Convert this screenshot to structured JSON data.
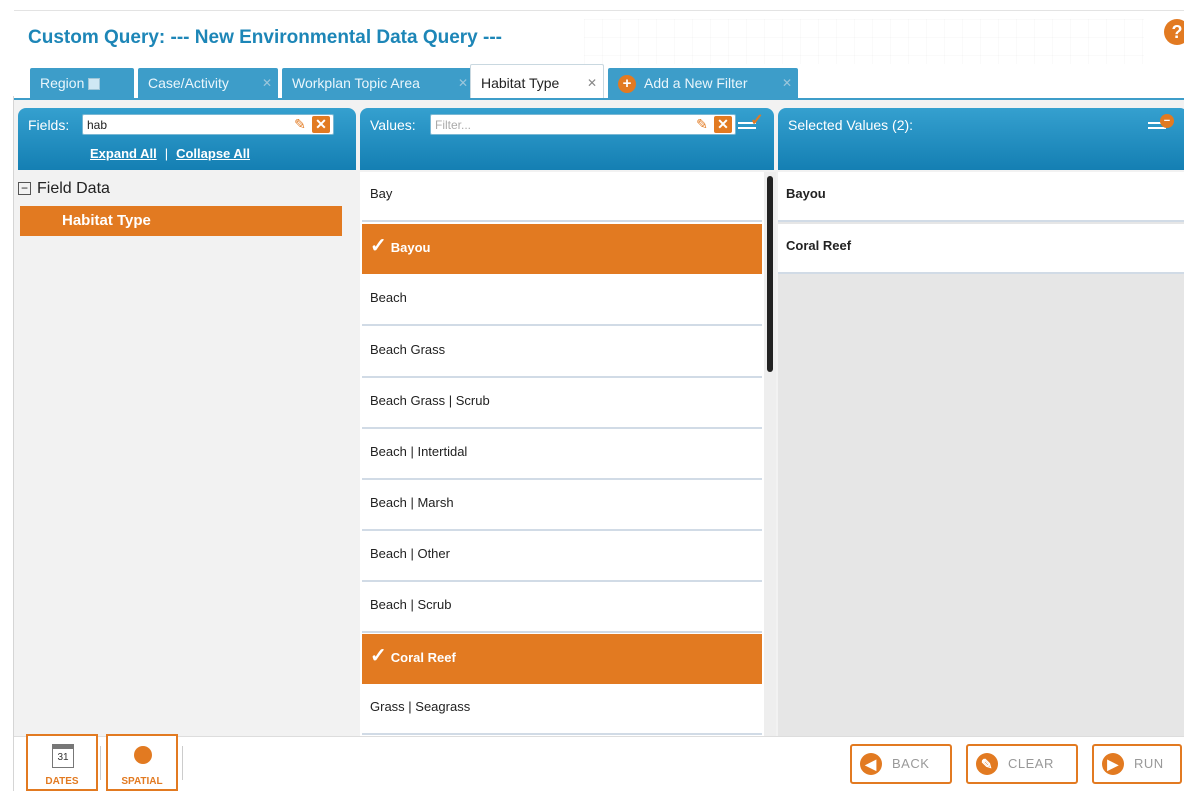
{
  "header": {
    "title": "Custom Query: --- New Environmental Data Query ---",
    "help_icon": "help-icon"
  },
  "tabs": [
    {
      "label": "Region"
    },
    {
      "label": "Case/Activity"
    },
    {
      "label": "Workplan Topic Area"
    },
    {
      "label": "Habitat Type",
      "active": true
    },
    {
      "label": "Add a New Filter"
    }
  ],
  "fields_panel": {
    "label": "Fields:",
    "search_value": "hab",
    "expand_all": "Expand All",
    "separator": "|",
    "collapse_all": "Collapse All",
    "tree": {
      "root": "Field Data",
      "child": "Habitat Type"
    }
  },
  "values_panel": {
    "label": "Values:",
    "filter_placeholder": "Filter...",
    "items": [
      {
        "label": "Bay",
        "selected": false
      },
      {
        "label": "Bayou",
        "selected": true
      },
      {
        "label": "Beach",
        "selected": false
      },
      {
        "label": "Beach Grass",
        "selected": false
      },
      {
        "label": "Beach Grass | Scrub",
        "selected": false
      },
      {
        "label": "Beach | Intertidal",
        "selected": false
      },
      {
        "label": "Beach | Marsh",
        "selected": false
      },
      {
        "label": "Beach | Other",
        "selected": false
      },
      {
        "label": "Beach | Scrub",
        "selected": false
      },
      {
        "label": "Coral Reef",
        "selected": true
      },
      {
        "label": "Grass | Seagrass",
        "selected": false
      }
    ]
  },
  "selected_panel": {
    "label": "Selected Values (2):",
    "items": [
      "Bayou",
      "Coral Reef"
    ]
  },
  "bottom": {
    "dates_label": "DATES",
    "dates_day": "31",
    "spatial_label": "SPATIAL",
    "back": "BACK",
    "clear": "CLEAR",
    "run": "RUN"
  },
  "colors": {
    "accent": "#e27a21",
    "primary": "#1d86b7",
    "tab": "#3d9dc9"
  }
}
